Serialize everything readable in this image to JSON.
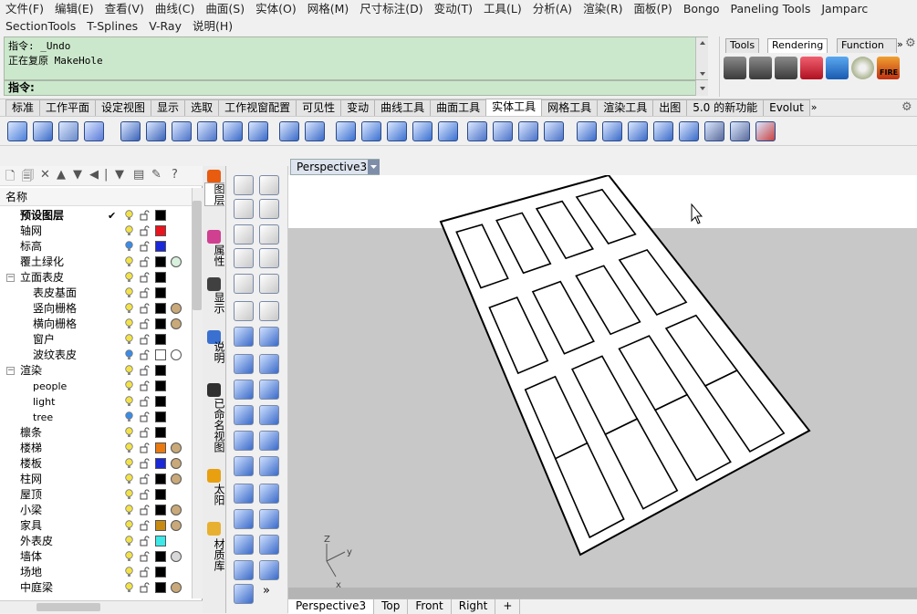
{
  "menu": {
    "row1": [
      "文件(F)",
      "编辑(E)",
      "查看(V)",
      "曲线(C)",
      "曲面(S)",
      "实体(O)",
      "网格(M)",
      "尺寸标注(D)",
      "变动(T)",
      "工具(L)",
      "分析(A)",
      "渲染(R)",
      "面板(P)",
      "Bongo",
      "Paneling Tools",
      "Jamparc"
    ],
    "row2": [
      "SectionTools",
      "T-Splines",
      "V-Ray",
      "说明(H)"
    ]
  },
  "command": {
    "history": [
      "指令: _Undo",
      "正在复原 MakeHole"
    ],
    "prompt": "指令:"
  },
  "render_panel": {
    "tabs": [
      "Tools",
      "Rendering",
      "Function"
    ],
    "active_tab": "Rendering",
    "more": "»"
  },
  "tabs": [
    "标准",
    "工作平面",
    "设定视图",
    "显示",
    "选取",
    "工作视窗配置",
    "可见性",
    "变动",
    "曲线工具",
    "曲面工具",
    "实体工具",
    "网格工具",
    "渲染工具",
    "出图",
    "5.0 的新功能",
    "Evolut"
  ],
  "active_tab": "实体工具",
  "tabs_more": "»",
  "layers": {
    "header": "名称",
    "rows": [
      {
        "name": "预设图层",
        "level": 0,
        "bold": true,
        "current": true,
        "check": "✔",
        "color": "#000000",
        "material": false,
        "bulb": "#f2e24a"
      },
      {
        "name": "轴网",
        "level": 0,
        "color": "#e8141e",
        "material": false,
        "bulb": "#f2e24a"
      },
      {
        "name": "标高",
        "level": 0,
        "color": "#1a28d8",
        "material": false,
        "bulb": "#3b8ce8"
      },
      {
        "name": "覆土绿化",
        "level": 0,
        "color": "#000000",
        "material": true,
        "matcolor": "#d8f0dc",
        "bulb": "#f2e24a"
      },
      {
        "name": "立面表皮",
        "level": 0,
        "expander": "−",
        "color": "#000000",
        "material": false,
        "bulb": "#f2e24a"
      },
      {
        "name": "表皮基面",
        "level": 1,
        "color": "#000000",
        "material": false,
        "bulb": "#f2e24a"
      },
      {
        "name": "竖向栅格",
        "level": 1,
        "color": "#000000",
        "material": true,
        "matcolor": "#c9a97a",
        "bulb": "#f2e24a"
      },
      {
        "name": "横向栅格",
        "level": 1,
        "color": "#000000",
        "material": true,
        "matcolor": "#c9a97a",
        "bulb": "#f2e24a"
      },
      {
        "name": "窗户",
        "level": 1,
        "color": "#000000",
        "material": false,
        "bulb": "#f2e24a"
      },
      {
        "name": "波纹表皮",
        "level": 1,
        "color": "#ffffff",
        "material": true,
        "matcolor": "#ffffff",
        "bulb": "#3b8ce8"
      },
      {
        "name": "渲染",
        "level": 0,
        "expander": "−",
        "color": "#000000",
        "material": false,
        "bulb": "#f2e24a"
      },
      {
        "name": "people",
        "level": 1,
        "color": "#000000",
        "material": false,
        "bulb": "#f2e24a"
      },
      {
        "name": "light",
        "level": 1,
        "color": "#000000",
        "material": false,
        "bulb": "#f2e24a"
      },
      {
        "name": "tree",
        "level": 1,
        "color": "#000000",
        "material": false,
        "bulb": "#3b8ce8"
      },
      {
        "name": "檩条",
        "level": 0,
        "color": "#000000",
        "material": false,
        "bulb": "#f2e24a"
      },
      {
        "name": "楼梯",
        "level": 0,
        "color": "#e87a10",
        "material": true,
        "matcolor": "#c9a97a",
        "bulb": "#f2e24a"
      },
      {
        "name": "楼板",
        "level": 0,
        "color": "#1a28d8",
        "material": true,
        "matcolor": "#c9a97a",
        "bulb": "#f2e24a"
      },
      {
        "name": "柱网",
        "level": 0,
        "color": "#000000",
        "material": true,
        "matcolor": "#c9a97a",
        "bulb": "#f2e24a"
      },
      {
        "name": "屋顶",
        "level": 0,
        "color": "#000000",
        "material": false,
        "bulb": "#f2e24a"
      },
      {
        "name": "小梁",
        "level": 0,
        "color": "#000000",
        "material": true,
        "matcolor": "#c9a97a",
        "bulb": "#f2e24a"
      },
      {
        "name": "家具",
        "level": 0,
        "color": "#c88a10",
        "material": true,
        "matcolor": "#c9a97a",
        "bulb": "#f2e24a"
      },
      {
        "name": "外表皮",
        "level": 0,
        "color": "#3ce8e8",
        "material": false,
        "bulb": "#f2e24a"
      },
      {
        "name": "墙体",
        "level": 0,
        "color": "#000000",
        "material": true,
        "matcolor": "#d8d8d8",
        "bulb": "#f2e24a"
      },
      {
        "name": "场地",
        "level": 0,
        "color": "#000000",
        "material": false,
        "bulb": "#f2e24a"
      },
      {
        "name": "中庭梁",
        "level": 0,
        "color": "#000000",
        "material": true,
        "matcolor": "#c9a97a",
        "bulb": "#f2e24a"
      }
    ]
  },
  "side_tabs": [
    "图层",
    "属性",
    "显示",
    "说明",
    "已命名视图",
    "太阳",
    "材质库"
  ],
  "active_side_tab": "图层",
  "viewport": {
    "title": "Perspective3",
    "axis_labels": {
      "z": "Z",
      "y": "y",
      "x": "x"
    }
  },
  "viewport_tabs": [
    "Perspective3",
    "Top",
    "Front",
    "Right",
    "+"
  ],
  "active_viewport_tab": "Perspective3",
  "vtool_more": "»",
  "colors": {
    "command_bg": "#cce8cc",
    "viewport_bg": "#c8c8c8",
    "viewport_title_bg": "#dde4ee"
  }
}
